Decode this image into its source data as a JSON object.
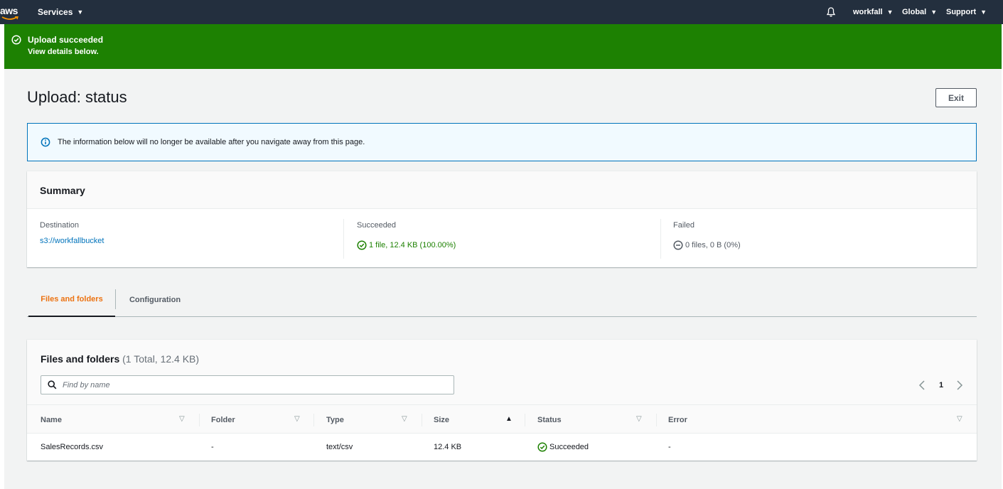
{
  "topnav": {
    "logo_text": "aws",
    "services_label": "Services",
    "account_label": "workfall",
    "region_label": "Global",
    "support_label": "Support",
    "bell_icon": "bell-icon",
    "caret_icon": "caret-down-icon",
    "background": "#232f3e"
  },
  "flash": {
    "title": "Upload succeeded",
    "subtitle": "View details below.",
    "icon": "check-circle-icon",
    "color": "#1d8102"
  },
  "page": {
    "title": "Upload: status",
    "exit_label": "Exit"
  },
  "info_alert": {
    "text": "The information below will no longer be available after you navigate away from this page.",
    "icon": "info-icon",
    "border_color": "#0073bb"
  },
  "summary": {
    "title": "Summary",
    "destination_label": "Destination",
    "destination_value": "s3://workfallbucket",
    "succeeded_label": "Succeeded",
    "succeeded_value": "1 file, 12.4 KB (100.00%)",
    "failed_label": "Failed",
    "failed_value": "0 files, 0 B (0%)"
  },
  "tabs": [
    {
      "label": "Files and folders",
      "active": true
    },
    {
      "label": "Configuration",
      "active": false
    }
  ],
  "files": {
    "title": "Files and folders",
    "count": "(1 Total, 12.4 KB)",
    "search_placeholder": "Find by name",
    "search_value": "",
    "page_number": "1",
    "columns": [
      "Name",
      "Folder",
      "Type",
      "Size",
      "Status",
      "Error"
    ],
    "sorted_column": "Size",
    "rows": [
      {
        "name": "SalesRecords.csv",
        "folder": "-",
        "type": "text/csv",
        "size": "12.4 KB",
        "status": "Succeeded",
        "error": "-"
      }
    ]
  },
  "colors": {
    "accent_orange": "#ec7211",
    "link_blue": "#0073bb",
    "success_green": "#1d8102",
    "page_bg": "#f2f3f3"
  }
}
